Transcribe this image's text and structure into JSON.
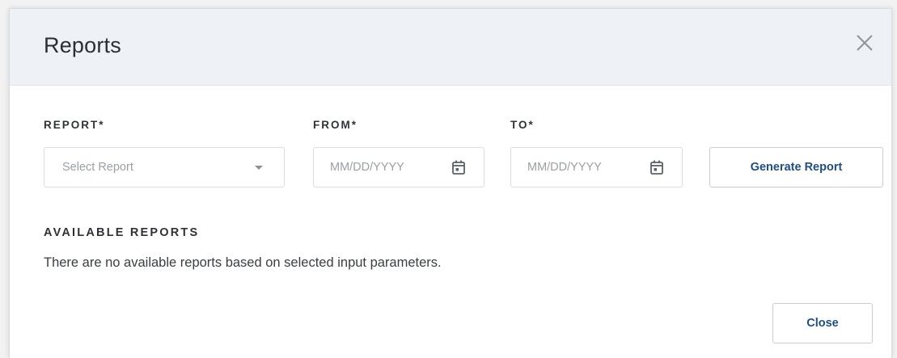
{
  "dialog": {
    "title": "Reports",
    "close_icon": "close-icon"
  },
  "form": {
    "report_label": "REPORT*",
    "report_placeholder": "Select Report",
    "from_label": "FROM*",
    "from_placeholder": "MM/DD/YYYY",
    "to_label": "TO*",
    "to_placeholder": "MM/DD/YYYY",
    "generate_button": "Generate Report"
  },
  "available": {
    "heading": "AVAILABLE REPORTS",
    "empty_message": "There are no available reports based on selected input parameters."
  },
  "footer": {
    "close_button": "Close"
  },
  "colors": {
    "header_bg": "#eef2f7",
    "accent": "#1f4e86",
    "border": "#d9dce0"
  }
}
